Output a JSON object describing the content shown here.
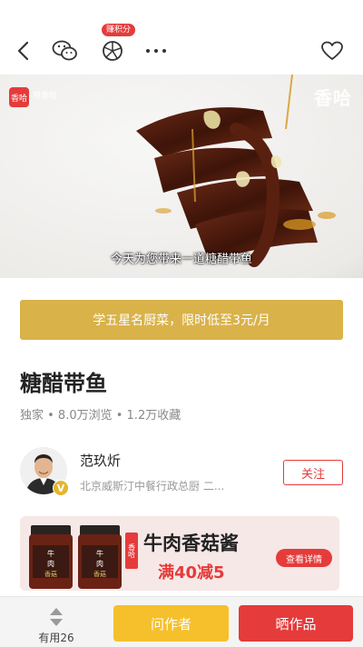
{
  "toolbar": {
    "points_badge": "赚积分",
    "icons": [
      "back-icon",
      "wechat-icon",
      "moments-icon",
      "more-icon",
      "heart-icon"
    ]
  },
  "video": {
    "logo_text": "香哈",
    "sub_logo": "用香哈",
    "watermark": "香哈",
    "caption": "今天为您带来一道糖醋带鱼"
  },
  "promo": {
    "text": "学五星名厨菜，限时低至3元/月"
  },
  "recipe": {
    "title": "糖醋带鱼",
    "stats": "独家 • 8.0万浏览 • 1.2万收藏"
  },
  "author": {
    "name": "范玖炘",
    "title": "北京威斯汀中餐行政总厨 二...",
    "badge": "V",
    "follow_label": "关注"
  },
  "ad": {
    "brand": "香哈",
    "title": "牛肉香菇酱",
    "promo": "满40减5",
    "button": "查看详情",
    "jar_label": "牛肉香菇酱"
  },
  "bottom": {
    "useful_label": "有用26",
    "ask_label": "问作者",
    "show_label": "晒作品"
  },
  "colors": {
    "accent_red": "#e53b3b",
    "promo_gold": "#d9b24a",
    "ask_yellow": "#f5c02c"
  }
}
